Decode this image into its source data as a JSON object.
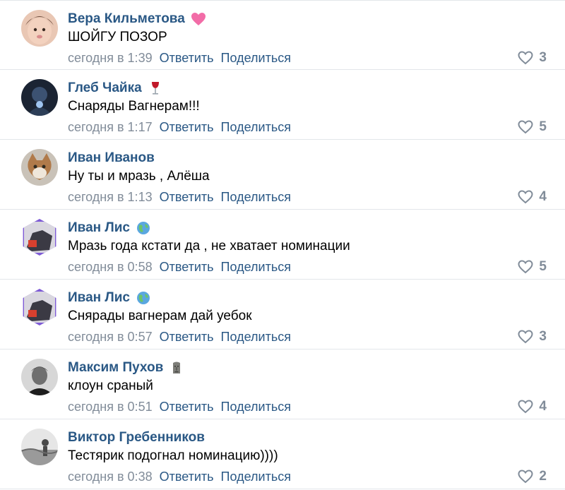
{
  "comments": [
    {
      "author": "Вера Кильметова",
      "badge_icon": "pink-heart-icon",
      "text": "ШОЙГУ ПОЗОР",
      "time": "сегодня в 1:39",
      "reply_label": "Ответить",
      "share_label": "Поделиться",
      "likes": "3"
    },
    {
      "author": "Глеб Чайка",
      "badge_icon": "wine-glass-icon",
      "text": "Снаряды Вагнерам!!!",
      "time": "сегодня в 1:17",
      "reply_label": "Ответить",
      "share_label": "Поделиться",
      "likes": "5"
    },
    {
      "author": "Иван Иванов",
      "text": "Ну ты и мразь , Алёша",
      "time": "сегодня в 1:13",
      "reply_label": "Ответить",
      "share_label": "Поделиться",
      "likes": "4"
    },
    {
      "author": "Иван Лис",
      "badge_icon": "globe-icon",
      "text": "Мразь года кстати да , не хватает номинации",
      "time": "сегодня в 0:58",
      "reply_label": "Ответить",
      "share_label": "Поделиться",
      "likes": "5"
    },
    {
      "author": "Иван Лис",
      "badge_icon": "globe-icon",
      "text": "Снярады вагнерам дай уебок",
      "time": "сегодня в 0:57",
      "reply_label": "Ответить",
      "share_label": "Поделиться",
      "likes": "3"
    },
    {
      "author": "Максим Пухов",
      "badge_icon": "moai-icon",
      "text": "клоун сраный",
      "time": "сегодня в 0:51",
      "reply_label": "Ответить",
      "share_label": "Поделиться",
      "likes": "4"
    },
    {
      "author": "Виктор Гребенников",
      "text": "Тестярик подогнал номинацию))))",
      "time": "сегодня в 0:38",
      "reply_label": "Ответить",
      "share_label": "Поделиться",
      "likes": "2"
    }
  ],
  "colors": {
    "link": "#2a5885",
    "muted": "#818c99",
    "text": "#000000",
    "divider": "#e3e6ea"
  }
}
